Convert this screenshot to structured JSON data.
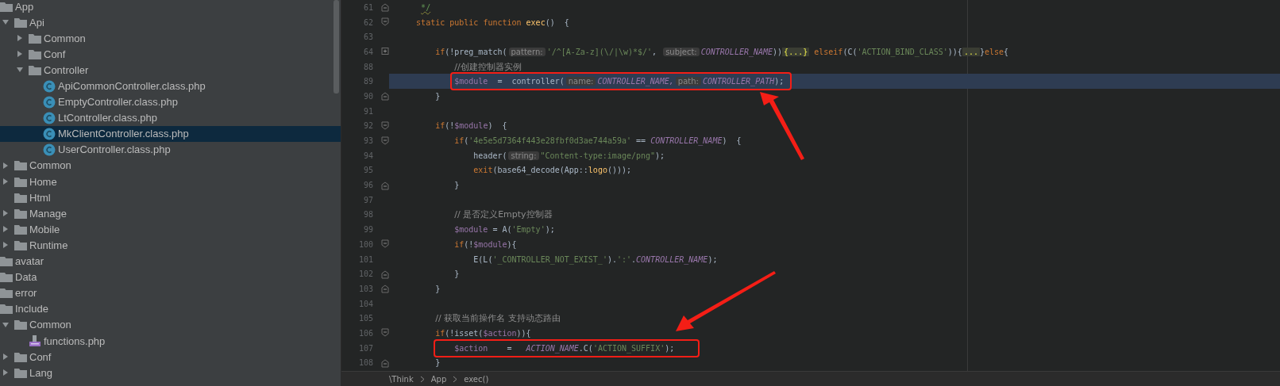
{
  "project_tree": [
    {
      "kind": "folder",
      "label": "App",
      "children": [
        {
          "kind": "folder",
          "label": "Api",
          "expanded": true,
          "children": [
            {
              "kind": "folder",
              "label": "Common",
              "expanded": false
            },
            {
              "kind": "folder",
              "label": "Conf",
              "expanded": false
            },
            {
              "kind": "folder",
              "label": "Controller",
              "expanded": true,
              "children": [
                {
                  "kind": "class",
                  "label": "ApiCommonController.class.php",
                  "selected": false
                },
                {
                  "kind": "class",
                  "label": "EmptyController.class.php",
                  "selected": false
                },
                {
                  "kind": "class",
                  "label": "LtController.class.php",
                  "selected": false
                },
                {
                  "kind": "class",
                  "label": "MkClientController.class.php",
                  "selected": true
                },
                {
                  "kind": "class",
                  "label": "UserController.class.php",
                  "selected": false
                }
              ]
            }
          ]
        },
        {
          "kind": "folder",
          "label": "Common",
          "expanded": false
        },
        {
          "kind": "folder",
          "label": "Home",
          "expanded": false
        },
        {
          "kind": "folder",
          "label": "Html"
        },
        {
          "kind": "folder",
          "label": "Manage",
          "expanded": false
        },
        {
          "kind": "folder",
          "label": "Mobile",
          "expanded": false
        },
        {
          "kind": "folder",
          "label": "Runtime",
          "expanded": false
        }
      ]
    },
    {
      "kind": "folder",
      "label": "avatar"
    },
    {
      "kind": "folder",
      "label": "Data"
    },
    {
      "kind": "folder",
      "label": "error"
    },
    {
      "kind": "folder",
      "label": "Include",
      "children": [
        {
          "kind": "folder",
          "label": "Common",
          "expanded": true,
          "children": [
            {
              "kind": "php",
              "label": "functions.php",
              "selected": false
            }
          ]
        },
        {
          "kind": "folder",
          "label": "Conf",
          "expanded": false
        },
        {
          "kind": "folder",
          "label": "Lang",
          "expanded": false
        }
      ]
    }
  ],
  "editor": {
    "lines": [
      {
        "number": "61",
        "fold_start": false,
        "tokens": [
          {
            "kind": "doc",
            "text": "     */"
          }
        ]
      },
      {
        "number": "62",
        "fold_start": true,
        "collapsed": false,
        "tokens": [
          {
            "kind": "keyword",
            "text": "    static public function "
          },
          {
            "kind": "function",
            "text": "exec"
          },
          {
            "kind": "plain",
            "text": "()  {"
          }
        ]
      },
      {
        "number": "63"
      },
      {
        "number": "64",
        "fold_start": true,
        "collapsed": true,
        "tokens": [
          {
            "kind": "keyword",
            "text": "        if"
          },
          {
            "kind": "plain",
            "text": "(!preg_match("
          },
          {
            "kind": "hint",
            "text": "pattern:"
          },
          {
            "kind": "string",
            "text": "'/^[A-Za-z](\\/|\\w)*$/'"
          },
          {
            "kind": "plain",
            "text": ", "
          },
          {
            "kind": "hint",
            "text": "subject:"
          },
          {
            "kind": "constant",
            "text": "CONTROLLER_NAME"
          },
          {
            "kind": "plain",
            "text": "))"
          },
          {
            "kind": "folded",
            "text": "{...}"
          },
          {
            "kind": "keyword",
            "text": " elseif"
          },
          {
            "kind": "plain",
            "text": "(C("
          },
          {
            "kind": "string",
            "text": "'ACTION_BIND_CLASS'"
          },
          {
            "kind": "plain",
            "text": ")){"
          },
          {
            "kind": "folded",
            "text": "..."
          },
          {
            "kind": "plain",
            "text": "}"
          },
          {
            "kind": "keyword",
            "text": "else"
          },
          {
            "kind": "plain",
            "text": "{"
          }
        ]
      },
      {
        "number": "88",
        "tokens": [
          {
            "kind": "comment",
            "text": "            //创建控制器实例"
          }
        ]
      },
      {
        "number": "89",
        "current": true,
        "annotated": true,
        "arrow_from_below": true,
        "tokens": [
          {
            "kind": "variable",
            "text": "            $module"
          },
          {
            "kind": "plain",
            "text": "  =  controller("
          },
          {
            "kind": "hint",
            "text": "name:"
          },
          {
            "kind": "constant",
            "text": "CONTROLLER_NAME,"
          },
          {
            "kind": "hint",
            "text": "path:"
          },
          {
            "kind": "constant",
            "text": "CONTROLLER_PATH"
          },
          {
            "kind": "plain",
            "text": ");"
          }
        ]
      },
      {
        "number": "90",
        "fold_start": false,
        "tokens": [
          {
            "kind": "plain",
            "text": "        }"
          }
        ]
      },
      {
        "number": "91"
      },
      {
        "number": "92",
        "fold_start": true,
        "collapsed": false,
        "tokens": [
          {
            "kind": "keyword",
            "text": "        if"
          },
          {
            "kind": "plain",
            "text": "(!"
          },
          {
            "kind": "variable",
            "text": "$module"
          },
          {
            "kind": "plain",
            "text": ")  {"
          }
        ]
      },
      {
        "number": "93",
        "fold_start": true,
        "collapsed": false,
        "tokens": [
          {
            "kind": "keyword",
            "text": "            if"
          },
          {
            "kind": "plain",
            "text": "("
          },
          {
            "kind": "string",
            "text": "'4e5e5d7364f443e28fbf0d3ae744a59a'"
          },
          {
            "kind": "plain",
            "text": " == "
          },
          {
            "kind": "constant",
            "text": "CONTROLLER_NAME"
          },
          {
            "kind": "plain",
            "text": ")  {"
          }
        ]
      },
      {
        "number": "94",
        "tokens": [
          {
            "kind": "plain",
            "text": "                header("
          },
          {
            "kind": "hint",
            "text": "string:"
          },
          {
            "kind": "string",
            "text": "\"Content-type:image/png\""
          },
          {
            "kind": "plain",
            "text": ");"
          }
        ]
      },
      {
        "number": "95",
        "tokens": [
          {
            "kind": "keyword",
            "text": "                exit"
          },
          {
            "kind": "plain",
            "text": "(base64_decode(App::"
          },
          {
            "kind": "function",
            "text": "logo"
          },
          {
            "kind": "plain",
            "text": "()));"
          }
        ]
      },
      {
        "number": "96",
        "fold_start": false,
        "tokens": [
          {
            "kind": "plain",
            "text": "            }"
          }
        ]
      },
      {
        "number": "97"
      },
      {
        "number": "98",
        "tokens": [
          {
            "kind": "comment",
            "text": "            // 是否定义Empty控制器"
          }
        ]
      },
      {
        "number": "99",
        "tokens": [
          {
            "kind": "variable",
            "text": "            $module"
          },
          {
            "kind": "plain",
            "text": " = A("
          },
          {
            "kind": "string",
            "text": "'Empty'"
          },
          {
            "kind": "plain",
            "text": ");"
          }
        ]
      },
      {
        "number": "100",
        "fold_start": true,
        "collapsed": false,
        "tokens": [
          {
            "kind": "keyword",
            "text": "            if"
          },
          {
            "kind": "plain",
            "text": "(!"
          },
          {
            "kind": "variable",
            "text": "$module"
          },
          {
            "kind": "plain",
            "text": "){"
          }
        ]
      },
      {
        "number": "101",
        "tokens": [
          {
            "kind": "plain",
            "text": "                E(L("
          },
          {
            "kind": "string",
            "text": "'_CONTROLLER_NOT_EXIST_'"
          },
          {
            "kind": "plain",
            "text": ")."
          },
          {
            "kind": "string",
            "text": "':'"
          },
          {
            "kind": "plain",
            "text": "."
          },
          {
            "kind": "constant",
            "text": "CONTROLLER_NAME"
          },
          {
            "kind": "plain",
            "text": ");"
          }
        ]
      },
      {
        "number": "102",
        "fold_start": false,
        "tokens": [
          {
            "kind": "plain",
            "text": "            }"
          }
        ]
      },
      {
        "number": "103",
        "fold_start": false,
        "tokens": [
          {
            "kind": "plain",
            "text": "        }"
          }
        ]
      },
      {
        "number": "104"
      },
      {
        "number": "105",
        "tokens": [
          {
            "kind": "comment",
            "text": "        // 获取当前操作名 支持动态路由"
          }
        ]
      },
      {
        "number": "106",
        "fold_start": true,
        "collapsed": false,
        "tokens": [
          {
            "kind": "keyword",
            "text": "        if"
          },
          {
            "kind": "plain",
            "text": "(!isset("
          },
          {
            "kind": "variable",
            "text": "$action"
          },
          {
            "kind": "plain",
            "text": ")){"
          }
        ]
      },
      {
        "number": "107",
        "annotated": true,
        "arrow_from_below": false,
        "tokens": [
          {
            "kind": "variable",
            "text": "            $action"
          },
          {
            "kind": "plain",
            "text": "    =   "
          },
          {
            "kind": "constant",
            "text": "ACTION_NAME"
          },
          {
            "kind": "plain",
            "text": ".C("
          },
          {
            "kind": "string",
            "text": "'ACTION_SUFFIX'"
          },
          {
            "kind": "plain",
            "text": ");"
          }
        ]
      },
      {
        "number": "108",
        "fold_start": false,
        "tokens": [
          {
            "kind": "plain",
            "text": "        }"
          }
        ]
      }
    ],
    "breadcrumb": [
      "\\Think",
      "App",
      "exec()"
    ]
  }
}
